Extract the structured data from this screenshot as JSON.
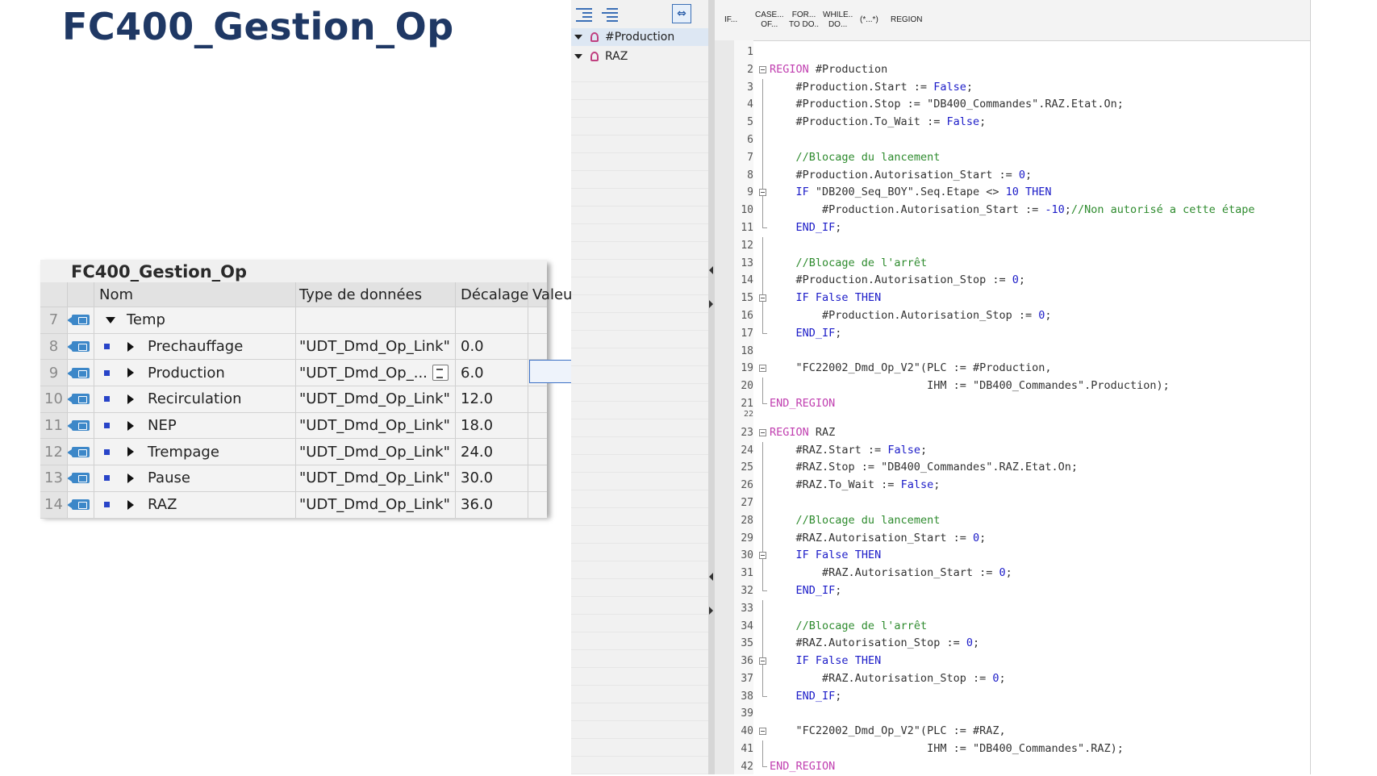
{
  "slide_title": "FC400_Gestion_Op",
  "var_table": {
    "title": "FC400_Gestion_Op",
    "headers": {
      "name": "Nom",
      "type": "Type de données",
      "offset": "Décalage",
      "value": "Valeur"
    },
    "rows": [
      {
        "num": "7",
        "name": "Temp",
        "type": "",
        "offset": "",
        "expanded": true
      },
      {
        "num": "8",
        "name": "Prechauffage",
        "type": "\"UDT_Dmd_Op_Link\"",
        "offset": "0.0"
      },
      {
        "num": "9",
        "name": "Production",
        "type": "\"UDT_Dmd_Op_...",
        "offset": "6.0",
        "selected": true
      },
      {
        "num": "10",
        "name": "Recirculation",
        "type": "\"UDT_Dmd_Op_Link\"",
        "offset": "12.0"
      },
      {
        "num": "11",
        "name": "NEP",
        "type": "\"UDT_Dmd_Op_Link\"",
        "offset": "18.0"
      },
      {
        "num": "12",
        "name": "Trempage",
        "type": "\"UDT_Dmd_Op_Link\"",
        "offset": "24.0"
      },
      {
        "num": "13",
        "name": "Pause",
        "type": "\"UDT_Dmd_Op_Link\"",
        "offset": "30.0"
      },
      {
        "num": "14",
        "name": "RAZ",
        "type": "\"UDT_Dmd_Op_Link\"",
        "offset": "36.0"
      }
    ]
  },
  "navigator": {
    "items": [
      "#Production",
      "RAZ"
    ]
  },
  "editor_toolbar": {
    "buttons": [
      {
        "line1": "IF...",
        "line2": ""
      },
      {
        "line1": "CASE...",
        "line2": "OF..."
      },
      {
        "line1": "FOR...",
        "line2": "TO DO.."
      },
      {
        "line1": "WHILE..",
        "line2": "DO..."
      },
      {
        "line1": "(*...*)",
        "line2": ""
      },
      {
        "line1": "REGION",
        "line2": ""
      }
    ]
  },
  "code_lines": [
    {
      "n": "1",
      "t": ""
    },
    {
      "n": "2",
      "t": "REGION #Production"
    },
    {
      "n": "3",
      "t": "    #Production.Start := False;"
    },
    {
      "n": "4",
      "t": "    #Production.Stop := \"DB400_Commandes\".RAZ.Etat.On;"
    },
    {
      "n": "5",
      "t": "    #Production.To_Wait := False;"
    },
    {
      "n": "6",
      "t": ""
    },
    {
      "n": "7",
      "t": "    //Blocage du lancement"
    },
    {
      "n": "8",
      "t": "    #Production.Autorisation_Start := 0;"
    },
    {
      "n": "9",
      "t": "    IF \"DB200_Seq_BOY\".Seq.Etape <> 10 THEN"
    },
    {
      "n": "10",
      "t": "        #Production.Autorisation_Start := -10;//Non autorisé a cette étape"
    },
    {
      "n": "11",
      "t": "    END_IF;"
    },
    {
      "n": "12",
      "t": ""
    },
    {
      "n": "13",
      "t": "    //Blocage de l'arrêt"
    },
    {
      "n": "14",
      "t": "    #Production.Autorisation_Stop := 0;"
    },
    {
      "n": "15",
      "t": "    IF False THEN"
    },
    {
      "n": "16",
      "t": "        #Production.Autorisation_Stop := 0;"
    },
    {
      "n": "17",
      "t": "    END_IF;"
    },
    {
      "n": "18",
      "t": ""
    },
    {
      "n": "19",
      "t": "    \"FC22002_Dmd_Op_V2\"(PLC := #Production,"
    },
    {
      "n": "20",
      "t": "                        IHM := \"DB400_Commandes\".Production);"
    },
    {
      "n": "21",
      "t": "END_REGION"
    },
    {
      "n": "22",
      "t": ""
    },
    {
      "n": "23",
      "t": "REGION RAZ"
    },
    {
      "n": "24",
      "t": "    #RAZ.Start := False;"
    },
    {
      "n": "25",
      "t": "    #RAZ.Stop := \"DB400_Commandes\".RAZ.Etat.On;"
    },
    {
      "n": "26",
      "t": "    #RAZ.To_Wait := False;"
    },
    {
      "n": "27",
      "t": ""
    },
    {
      "n": "28",
      "t": "    //Blocage du lancement"
    },
    {
      "n": "29",
      "t": "    #RAZ.Autorisation_Start := 0;"
    },
    {
      "n": "30",
      "t": "    IF False THEN"
    },
    {
      "n": "31",
      "t": "        #RAZ.Autorisation_Start := 0;"
    },
    {
      "n": "32",
      "t": "    END_IF;"
    },
    {
      "n": "33",
      "t": ""
    },
    {
      "n": "34",
      "t": "    //Blocage de l'arrêt"
    },
    {
      "n": "35",
      "t": "    #RAZ.Autorisation_Stop := 0;"
    },
    {
      "n": "36",
      "t": "    IF False THEN"
    },
    {
      "n": "37",
      "t": "        #RAZ.Autorisation_Stop := 0;"
    },
    {
      "n": "38",
      "t": "    END_IF;"
    },
    {
      "n": "39",
      "t": ""
    },
    {
      "n": "40",
      "t": "    \"FC22002_Dmd_Op_V2\"(PLC := #RAZ,"
    },
    {
      "n": "41",
      "t": "                        IHM := \"DB400_Commandes\".RAZ);"
    },
    {
      "n": "42",
      "t": "END_REGION"
    }
  ]
}
